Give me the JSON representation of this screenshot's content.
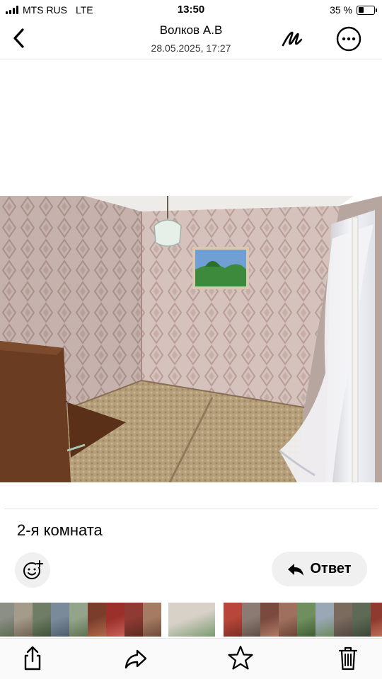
{
  "status_bar": {
    "carrier": "MTS RUS",
    "network": "LTE",
    "time": "13:50",
    "battery_text": "35 %",
    "battery_level": 0.35
  },
  "header": {
    "title": "Волков А.В",
    "subtitle": "28.05.2025, 17:27",
    "back_icon": "chevron-left-icon",
    "markup_icon": "markup-pen-icon",
    "more_icon": "more-circle-icon"
  },
  "message": {
    "caption": "2-я комната",
    "reply_label": "Ответ",
    "emoji_icon": "add-reaction-icon",
    "reply_icon": "reply-arrow-icon"
  },
  "thumbnails": {
    "selected_index": 9,
    "items": [
      "thumb-1",
      "thumb-2",
      "thumb-3",
      "thumb-4",
      "thumb-5",
      "thumb-6",
      "thumb-7",
      "thumb-8",
      "thumb-9",
      "thumb-10",
      "thumb-11",
      "thumb-12",
      "thumb-13",
      "thumb-14",
      "thumb-15",
      "thumb-16",
      "thumb-17",
      "thumb-18",
      "thumb-19",
      "thumb-20",
      "thumb-21"
    ]
  },
  "toolbar": {
    "share_icon": "share-icon",
    "forward_icon": "forward-icon",
    "star_icon": "star-icon",
    "trash_icon": "trash-icon"
  }
}
